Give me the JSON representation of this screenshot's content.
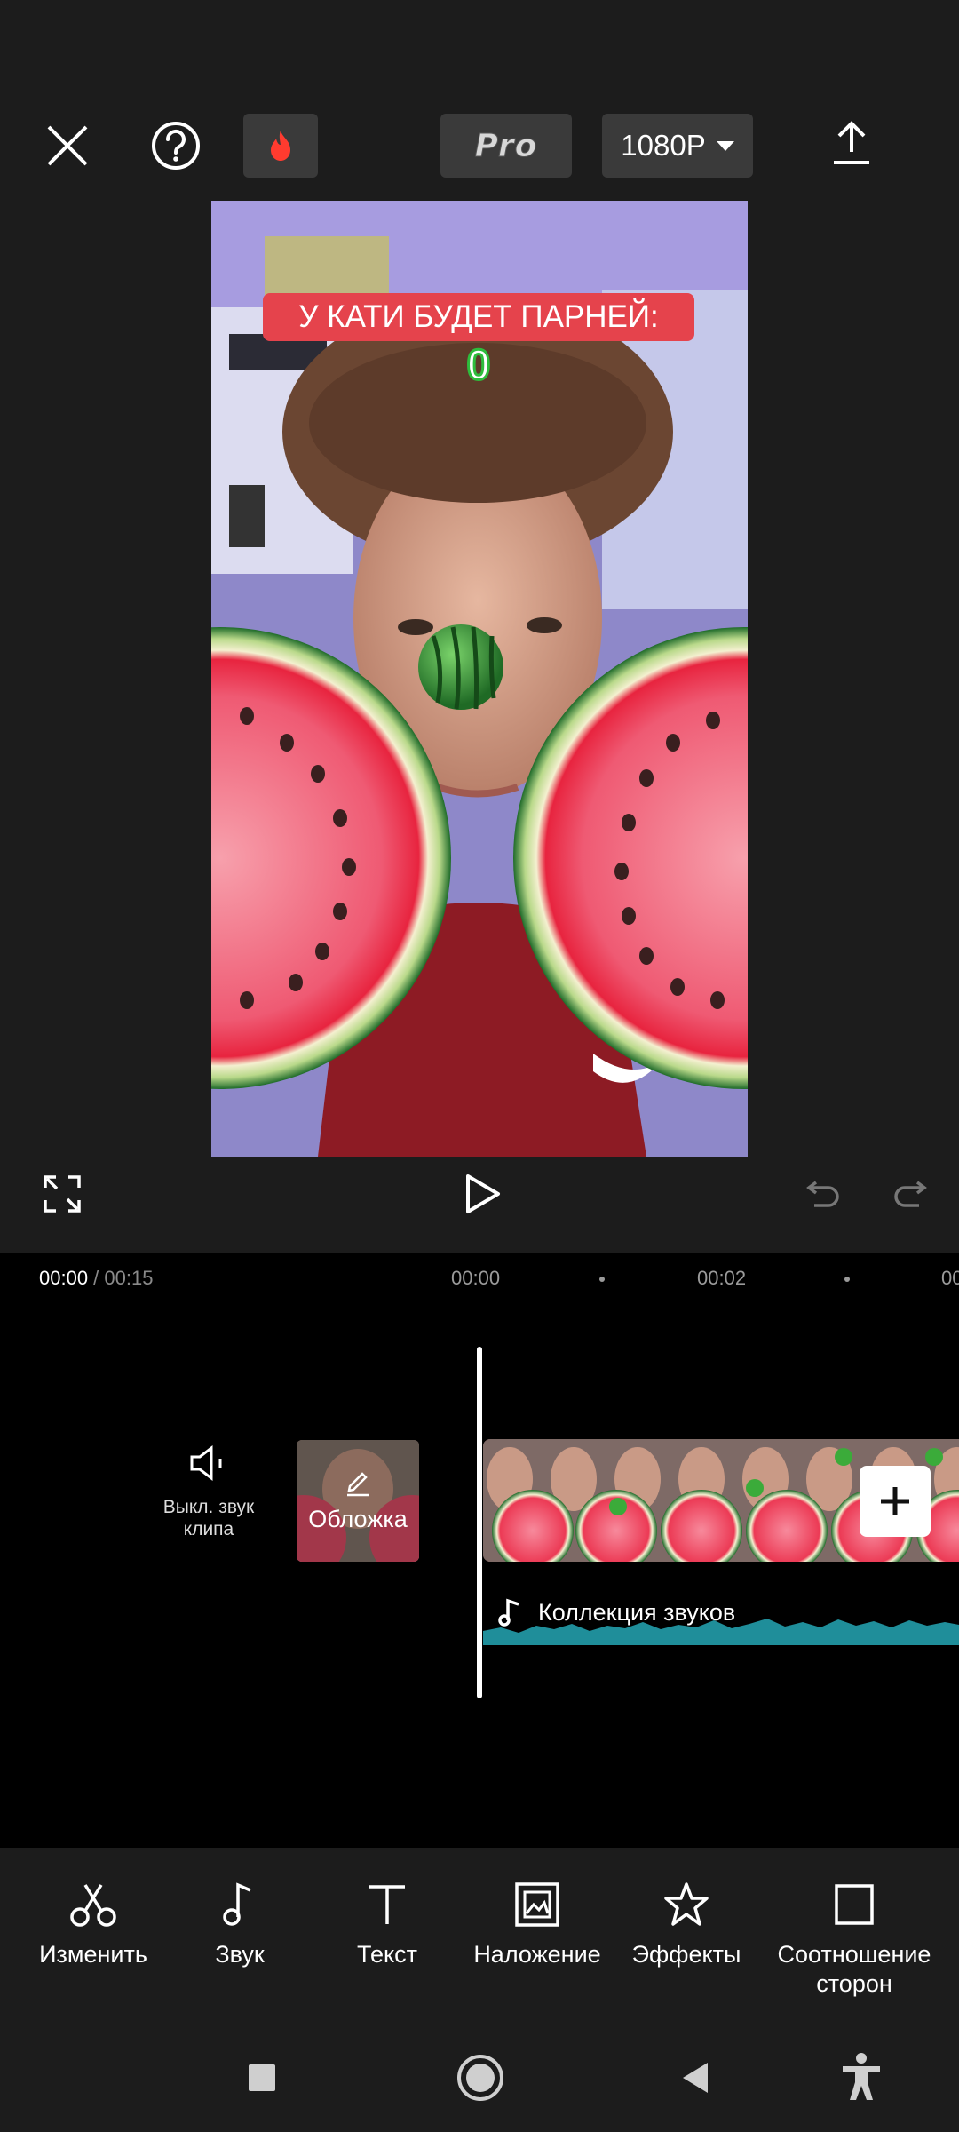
{
  "top_bar": {
    "pro_label": "Pro",
    "resolution": "1080P"
  },
  "preview": {
    "caption": "У КАТИ БУДЕТ ПАРНЕЙ:",
    "counter": "0"
  },
  "timeline": {
    "current_time": "00:00",
    "separator": " / ",
    "total_time": "00:15",
    "ticks": [
      "00:00",
      "00:02",
      "00"
    ]
  },
  "track": {
    "mute_label": "Выкл. звук клипа",
    "cover_label": "Обложка",
    "audio_label": "Коллекция звуков"
  },
  "toolbar": {
    "items": [
      {
        "label": "Изменить",
        "icon": "scissors-icon"
      },
      {
        "label": "Звук",
        "icon": "music-note-icon"
      },
      {
        "label": "Текст",
        "icon": "text-icon"
      },
      {
        "label": "Наложение",
        "icon": "overlay-icon"
      },
      {
        "label": "Эффекты",
        "icon": "effects-star-icon"
      },
      {
        "label": "Соотношение сторон",
        "icon": "aspect-ratio-icon"
      }
    ]
  },
  "colors": {
    "background": "#1c1c1c",
    "timeline_bg": "#000000",
    "caption_bg": "#e5434c",
    "counter_green": "#2dbd3c",
    "waveform": "#1f8e9a",
    "fire": "#ff3b2f"
  }
}
